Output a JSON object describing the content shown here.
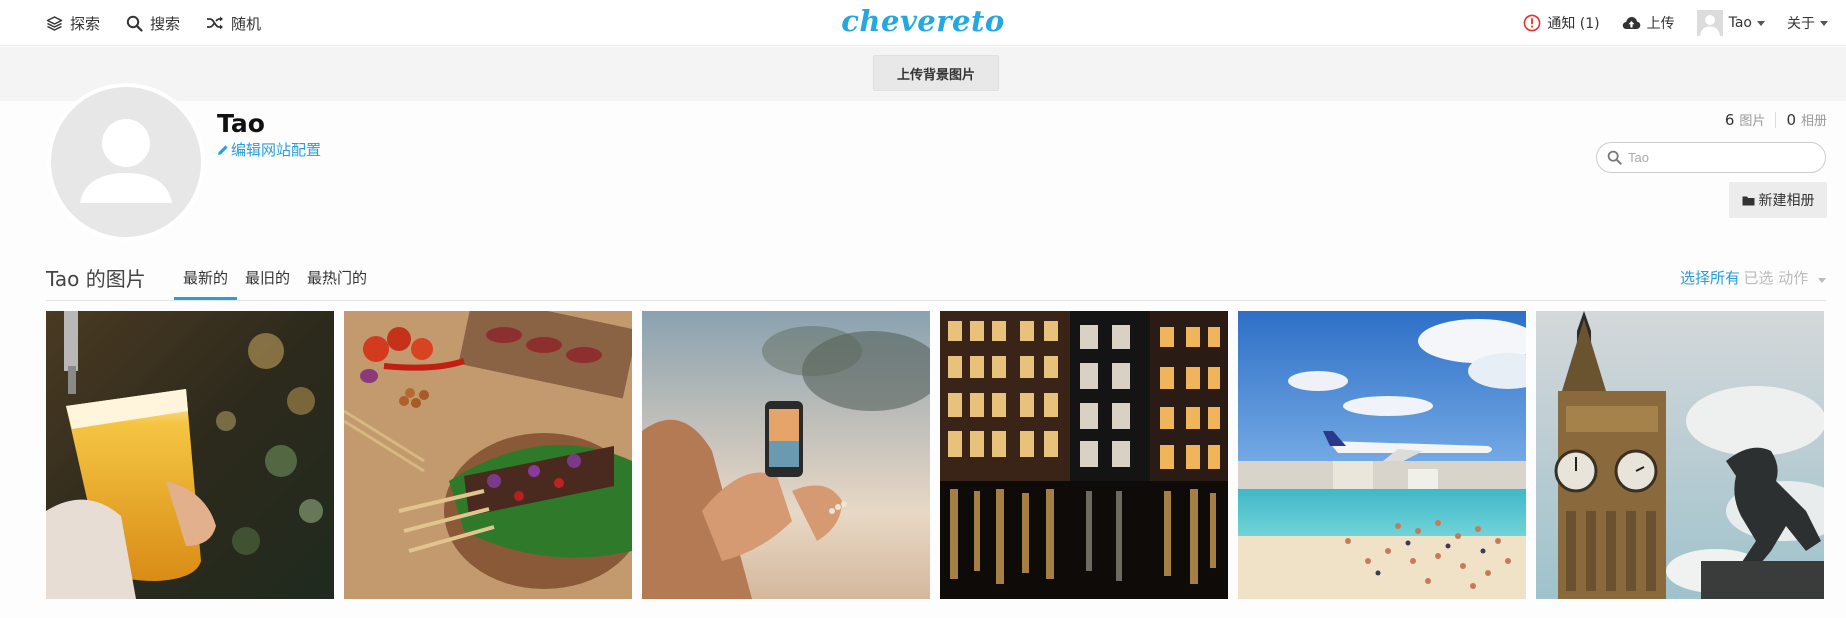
{
  "nav": {
    "explore": "探索",
    "search": "搜索",
    "random": "随机",
    "logo": "chevereto",
    "notifications": "通知 (1)",
    "upload": "上传",
    "user": "Tao",
    "about": "关于"
  },
  "cover": {
    "upload_bg_label": "上传背景图片"
  },
  "profile": {
    "name": "Tao",
    "edit_label": "编辑网站配置",
    "images_count": "6",
    "images_label": "图片",
    "albums_count": "0",
    "albums_label": "相册",
    "search_placeholder": "Tao",
    "new_album_label": "新建相册"
  },
  "listing": {
    "title": "Tao 的图片",
    "tabs": [
      "最新的",
      "最旧的",
      "最热门的"
    ],
    "select_all": "选择所有",
    "separator": "·",
    "actions": "已选 动作"
  },
  "gallery": [
    {
      "subject": "beer-glass-photo"
    },
    {
      "subject": "satay-food-photo"
    },
    {
      "subject": "phone-photography-beach-photo"
    },
    {
      "subject": "amsterdam-night-canal-photo"
    },
    {
      "subject": "airplane-beach-photo"
    },
    {
      "subject": "big-ben-statue-photo"
    }
  ],
  "colors": {
    "accent": "#2a9fd6",
    "logo": "#23a8e0",
    "notification_alert": "#e5322d"
  }
}
